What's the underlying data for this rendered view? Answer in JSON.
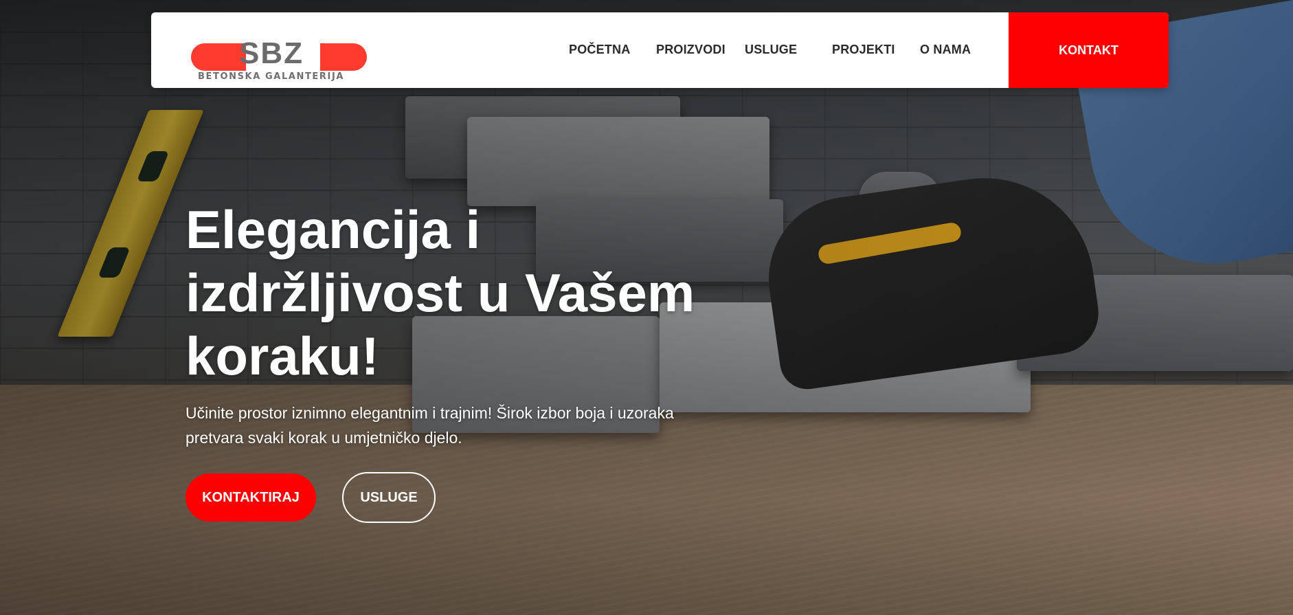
{
  "header": {
    "logo": {
      "text": "SBZ",
      "subtitle": "BETONSKA GALANTERIJA"
    },
    "nav": [
      {
        "label": "POČETNA"
      },
      {
        "label": "PROIZVODI"
      },
      {
        "label": "USLUGE"
      },
      {
        "label": "PROJEKTI"
      },
      {
        "label": "O NAMA"
      }
    ],
    "contact_label": "KONTAKT"
  },
  "hero": {
    "title_line1": "Elegancija i",
    "title_line2": "izdržljivost u Vašem",
    "title_line3": "koraku!",
    "text_line1": "Učinite prostor iznimno elegantnim i trajnim! Širok izbor boja i uzoraka",
    "text_line2": "pretvara svaki korak u umjetničko djelo.",
    "primary_button": "KONTAKTIRAJ",
    "secondary_button": "USLUGE"
  },
  "colors": {
    "accent": "#ff0000",
    "logo_red": "#ff3b30",
    "logo_grey": "#6b6b6b",
    "header_bg": "#ffffff",
    "text_light": "#ffffff"
  },
  "background": {
    "description_icon": "paving-stones-photo"
  }
}
